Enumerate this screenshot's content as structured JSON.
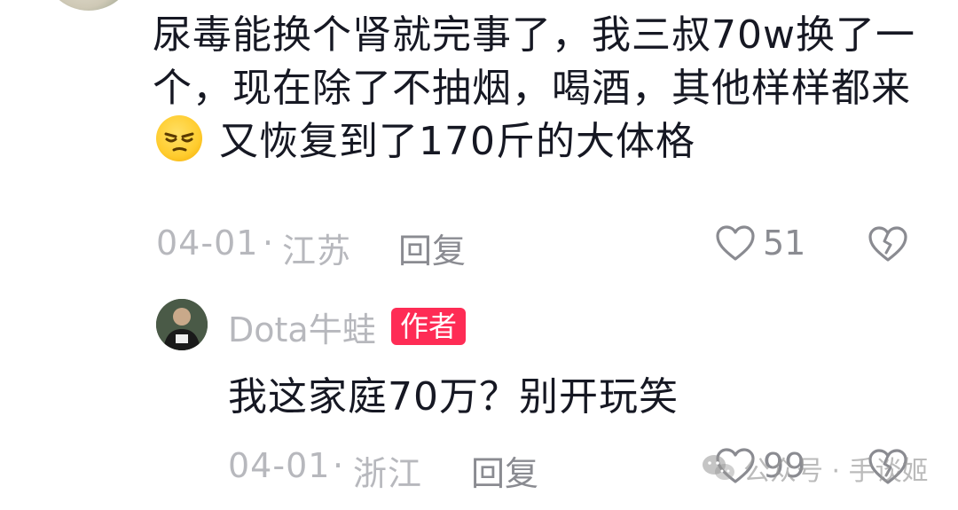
{
  "comment": {
    "text_part1": "尿毒能换个肾就完事了，我三叔70w换了一个，现在除了不抽烟，喝酒，其他样样都来",
    "emoji": "smirk-emoji",
    "text_part2": " 又恢复到了170斤的大体格",
    "date": "04-01",
    "separator": "·",
    "location": "江苏",
    "reply_label": "回复",
    "likes": "51"
  },
  "reply": {
    "username": "Dota牛蛙",
    "badge": "作者",
    "text": "我这家庭70万？别开玩笑",
    "date": "04-01",
    "separator": "·",
    "location": "浙江",
    "reply_label": "回复",
    "likes": "99"
  },
  "watermark": {
    "text": "公众号 · 手谈姬",
    "icon": "wechat-icon"
  }
}
